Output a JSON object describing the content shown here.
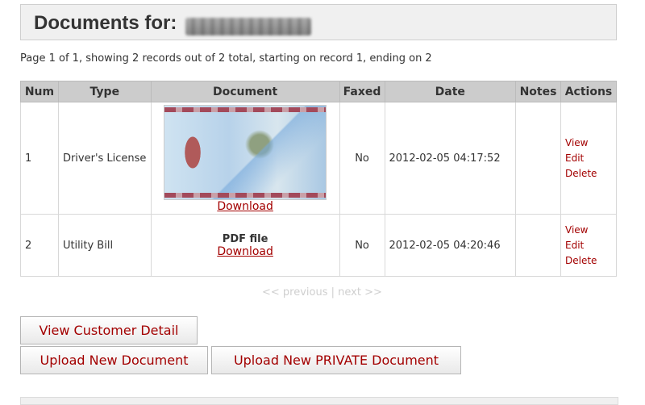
{
  "header": {
    "title": "Documents for:"
  },
  "paging_info": "Page 1 of 1, showing 2 records out of 2 total, starting on record 1, ending on 2",
  "table": {
    "headers": [
      "Num",
      "Type",
      "Document",
      "Faxed",
      "Date",
      "Notes",
      "Actions"
    ],
    "rows": [
      {
        "num": "1",
        "type": "Driver's License",
        "document_kind": "image",
        "document_link": "Download",
        "faxed": "No",
        "date": "2012-02-05 04:17:52",
        "notes": "",
        "actions": [
          "View",
          "Edit",
          "Delete"
        ]
      },
      {
        "num": "2",
        "type": "Utility Bill",
        "document_label": "PDF file",
        "document_link": "Download",
        "faxed": "No",
        "date": "2012-02-05 04:20:46",
        "notes": "",
        "actions": [
          "View",
          "Edit",
          "Delete"
        ]
      }
    ]
  },
  "pager": {
    "previous": "<< previous",
    "separator": "|",
    "next": "next >>"
  },
  "buttons": {
    "view_customer": "View Customer Detail",
    "upload_new": "Upload New Document",
    "upload_private": "Upload New PRIVATE Document"
  },
  "colors": {
    "link": "#a30000",
    "header_bg": "#cccccc",
    "pager_disabled": "#cfcfcf"
  }
}
